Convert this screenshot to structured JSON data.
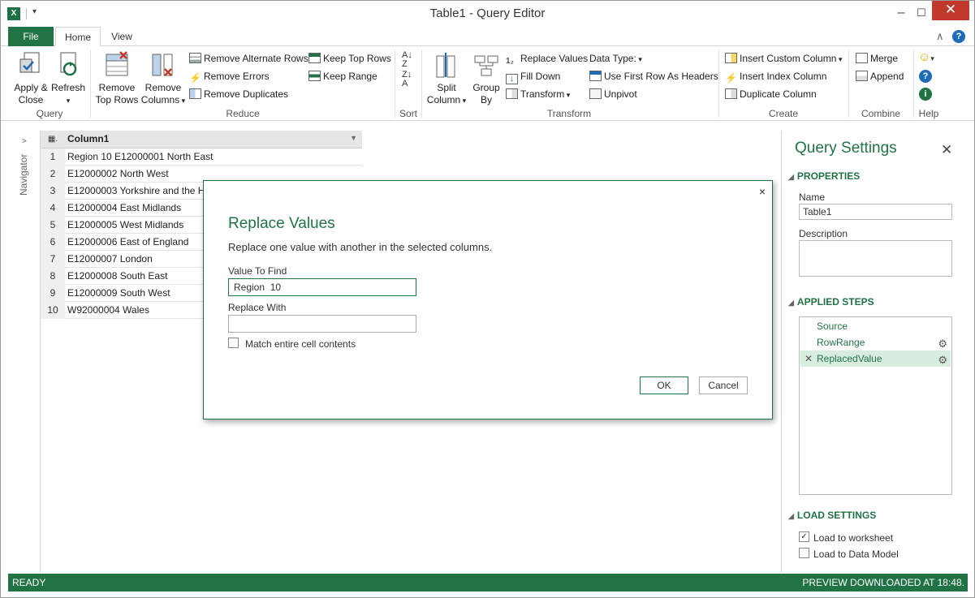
{
  "window": {
    "title": "Table1 - Query Editor",
    "minimize": "–",
    "maximize": "☐",
    "close": "✕"
  },
  "tabs": [
    {
      "label": "File"
    },
    {
      "label": "Home"
    },
    {
      "label": "View"
    }
  ],
  "ribbon": {
    "query": {
      "apply_close": "Apply &",
      "apply_close2": "Close",
      "refresh": "Refresh",
      "label": "Query"
    },
    "reduce": {
      "remove_top_rows": "Remove",
      "remove_top_rows2": "Top Rows",
      "remove_columns": "Remove",
      "remove_columns2": "Columns",
      "remove_alternate_rows": "Remove Alternate Rows",
      "remove_errors": "Remove Errors",
      "remove_duplicates": "Remove Duplicates",
      "keep_top_rows": "Keep Top Rows",
      "keep_range": "Keep Range",
      "label": "Reduce"
    },
    "sort": {
      "label": "Sort"
    },
    "transform": {
      "split_column": "Split",
      "split_column2": "Column",
      "group_by": "Group",
      "group_by2": "By",
      "replace_values": "Replace Values",
      "fill_down": "Fill Down",
      "transform": "Transform",
      "data_type": "Data Type:",
      "use_first_row": "Use First Row As Headers",
      "unpivot": "Unpivot",
      "label": "Transform"
    },
    "create": {
      "insert_custom_column": "Insert Custom Column",
      "insert_index_column": "Insert Index Column",
      "duplicate_column": "Duplicate Column",
      "label": "Create"
    },
    "combine": {
      "merge": "Merge",
      "append": "Append",
      "label": "Combine"
    },
    "help": {
      "label": "Help"
    }
  },
  "navigator": {
    "label": "Navigator"
  },
  "grid": {
    "header": "Column1",
    "rows": [
      {
        "index": "1",
        "value": "Region  10  E12000001 North East"
      },
      {
        "index": "2",
        "value": "E12000002 North West"
      },
      {
        "index": "3",
        "value": "E12000003 Yorkshire and the Humber"
      },
      {
        "index": "4",
        "value": "E12000004 East Midlands"
      },
      {
        "index": "5",
        "value": "E12000005 West Midlands"
      },
      {
        "index": "6",
        "value": "E12000006 East of England"
      },
      {
        "index": "7",
        "value": "E12000007 London"
      },
      {
        "index": "8",
        "value": "E12000008 South East"
      },
      {
        "index": "9",
        "value": "E12000009 South West"
      },
      {
        "index": "10",
        "value": "W92000004 Wales"
      }
    ]
  },
  "dialog": {
    "title": "Replace Values",
    "description": "Replace one value with another in the selected columns.",
    "value_to_find_label": "Value To Find",
    "value_to_find": "Region  10",
    "replace_with_label": "Replace With",
    "replace_with": "",
    "match_label": "Match entire cell contents",
    "ok": "OK",
    "cancel": "Cancel",
    "close": "×"
  },
  "query_settings": {
    "title": "Query Settings",
    "properties_head": "PROPERTIES",
    "name_label": "Name",
    "name_value": "Table1",
    "description_label": "Description",
    "applied_steps_head": "APPLIED STEPS",
    "steps": [
      {
        "label": "Source"
      },
      {
        "label": "RowRange"
      },
      {
        "label": "ReplacedValue"
      }
    ],
    "load_settings_head": "LOAD SETTINGS",
    "load_to_worksheet": "Load to worksheet",
    "load_to_data_model": "Load to Data Model"
  },
  "status": {
    "left": "READY",
    "right": "PREVIEW DOWNLOADED AT 18:48."
  },
  "colors": {
    "accent": "#217346"
  }
}
